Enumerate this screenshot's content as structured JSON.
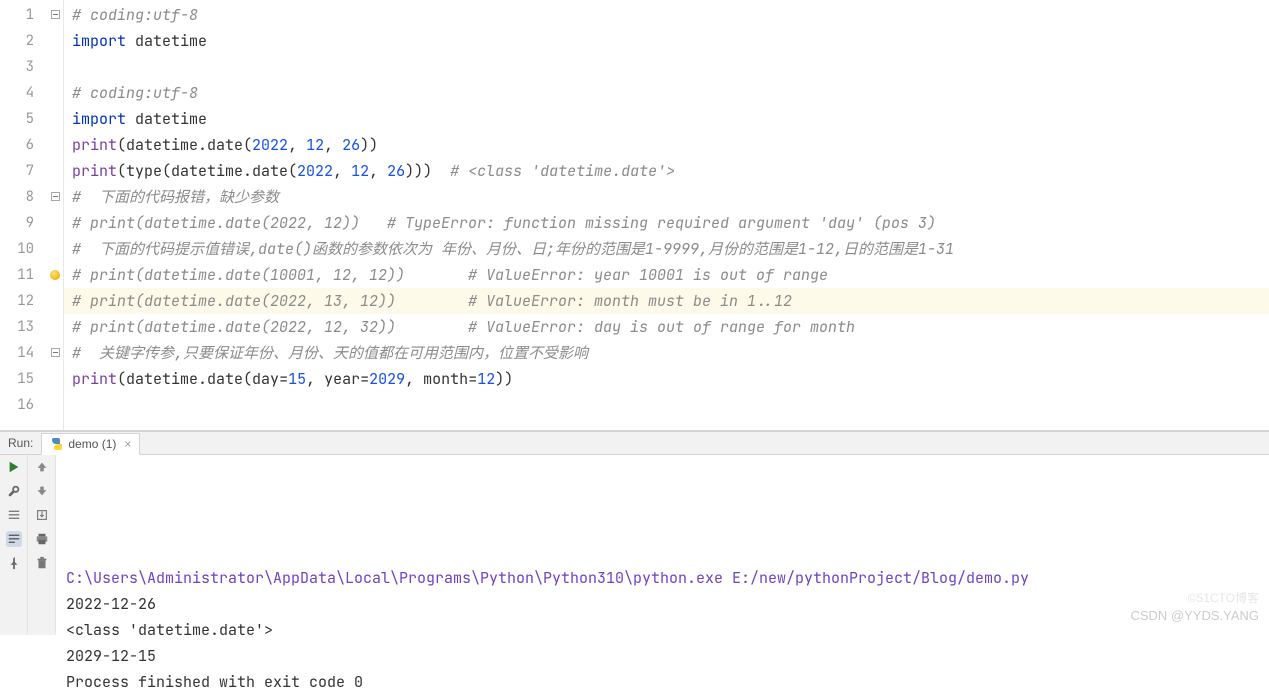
{
  "editor": {
    "lines": [
      {
        "n": 1,
        "fold": true,
        "type": "com",
        "raw": "# coding:utf-8"
      },
      {
        "n": 2,
        "type": "import",
        "kw": "import",
        "mod": "datetime"
      },
      {
        "n": 3,
        "type": "blank"
      },
      {
        "n": 4,
        "type": "com",
        "raw": "# coding:utf-8"
      },
      {
        "n": 5,
        "type": "import",
        "kw": "import",
        "mod": "datetime"
      },
      {
        "n": 6,
        "type": "call",
        "fn": "print",
        "inner": "datetime.date(2022, 12, 26)"
      },
      {
        "n": 7,
        "type": "call_comment",
        "fn": "print",
        "inner": "type(datetime.date(2022, 12, 26))",
        "comment": "# <class 'datetime.date'>"
      },
      {
        "n": 8,
        "fold": true,
        "type": "com",
        "raw": "#  下面的代码报错，缺少参数"
      },
      {
        "n": 9,
        "type": "com",
        "raw": "# print(datetime.date(2022, 12))   # TypeError: function missing required argument 'day' (pos 3)"
      },
      {
        "n": 10,
        "type": "com",
        "raw": "#  下面的代码提示值错误,date()函数的参数依次为 年份、月份、日;年份的范围是1-9999,月份的范围是1-12,日的范围是1-31"
      },
      {
        "n": 11,
        "bulb": true,
        "type": "com",
        "raw": "# print(datetime.date(10001, 12, 12))       # ValueError: year 10001 is out of range"
      },
      {
        "n": 12,
        "current": true,
        "type": "com",
        "raw": "# print(datetime.date(2022, 13, 12))        # ValueError: month must be in 1..12"
      },
      {
        "n": 13,
        "type": "com",
        "raw": "# print(datetime.date(2022, 12, 32))        # ValueError: day is out of range for month"
      },
      {
        "n": 14,
        "fold": true,
        "type": "com",
        "raw": "#  关键字传参,只要保证年份、月份、天的值都在可用范围内，位置不受影响"
      },
      {
        "n": 15,
        "type": "kwcall",
        "fn": "print",
        "prefix": "datetime.date(",
        "args": [
          [
            "day",
            "15"
          ],
          [
            "year",
            "2029"
          ],
          [
            "month",
            "12"
          ]
        ],
        "suffix": ")"
      },
      {
        "n": 16,
        "type": "blank"
      }
    ]
  },
  "run": {
    "label": "Run:",
    "tab_name": "demo (1)"
  },
  "console": {
    "cmd": "C:\\Users\\Administrator\\AppData\\Local\\Programs\\Python\\Python310\\python.exe E:/new/pythonProject/Blog/demo.py",
    "out": [
      "2022-12-26",
      "<class 'datetime.date'>",
      "2029-12-15",
      "",
      "Process finished with exit code 0"
    ]
  },
  "watermarks": {
    "csdn": "CSDN @YYDS.YANG",
    "cto": "©51CTO博客"
  }
}
